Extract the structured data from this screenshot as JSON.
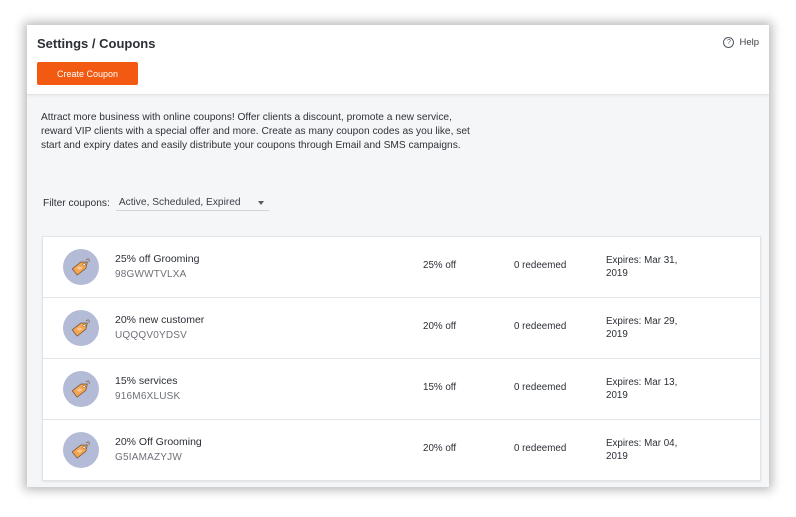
{
  "header": {
    "title": "Settings / Coupons",
    "help_label": "Help",
    "help_icon_glyph": "?",
    "create_button_label": "Create Coupon"
  },
  "intro_text": "Attract more business with online coupons! Offer clients a discount, promote a new service, reward VIP clients with a special offer and more. Create as many coupon codes as you like, set start and expiry dates and easily distribute your coupons through Email and SMS campaigns.",
  "filter": {
    "label": "Filter coupons:",
    "selected_value": "Active, Scheduled, Expired"
  },
  "coupon_icon": "price-tag-icon",
  "colors": {
    "accent": "#f25a12",
    "icon_circle": "#b3bbd6",
    "tag_fill": "#f5a653"
  },
  "coupons": [
    {
      "name": "25% off Grooming",
      "code": "98GWWTVLXA",
      "discount": "25% off",
      "redeemed": "0 redeemed",
      "expires": "Expires: Mar 31, 2019"
    },
    {
      "name": "20% new customer",
      "code": "UQQQV0YDSV",
      "discount": "20% off",
      "redeemed": "0 redeemed",
      "expires": "Expires: Mar 29, 2019"
    },
    {
      "name": "15% services",
      "code": "916M6XLUSK",
      "discount": "15% off",
      "redeemed": "0 redeemed",
      "expires": "Expires: Mar 13, 2019"
    },
    {
      "name": "20% Off Grooming",
      "code": "G5IAMAZYJW",
      "discount": "20% off",
      "redeemed": "0 redeemed",
      "expires": "Expires: Mar 04, 2019"
    }
  ]
}
